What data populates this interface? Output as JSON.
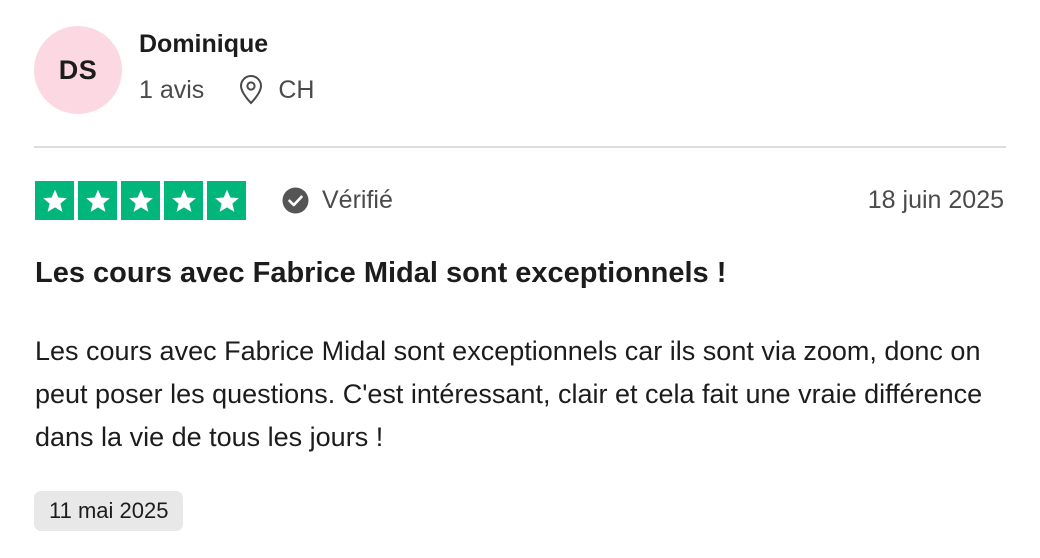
{
  "reviewer": {
    "initials": "DS",
    "name": "Dominique",
    "review_count": "1 avis",
    "country": "CH",
    "avatar_color": "#fcd8e3"
  },
  "review": {
    "rating": 5,
    "rating_max": 5,
    "star_color": "#00b67a",
    "verified_label": "Vérifié",
    "date": "18 juin 2025",
    "title": "Les cours avec Fabrice Midal sont exceptionnels !",
    "body": "Les cours avec Fabrice Midal sont exceptionnels car ils sont via zoom, donc on peut poser les questions. C'est intéressant, clair et cela fait une vraie différence dans la vie de tous les jours !",
    "experience_date": "11 mai 2025"
  },
  "icons": {
    "location": "location-pin-icon",
    "verified": "check-circle-icon",
    "star": "star-icon"
  }
}
